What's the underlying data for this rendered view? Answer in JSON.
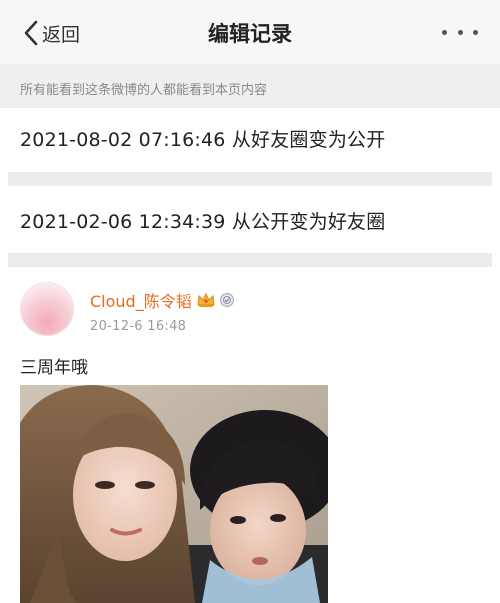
{
  "nav": {
    "back_label": "返回",
    "title": "编辑记录",
    "more_icon": "more-dots-icon"
  },
  "notice": "所有能看到这条微博的人都能看到本页内容",
  "records": [
    {
      "text": "2021-08-02 07:16:46 从好友圈变为公开"
    },
    {
      "text": "2021-02-06 12:34:39 从公开变为好友圈"
    }
  ],
  "post": {
    "username": "Cloud_陈令韬",
    "time": "20-12-6 16:48",
    "text": "三周年哦",
    "badges": [
      "crown-icon",
      "member-badge-icon"
    ],
    "photo": "couple-selfie-photo"
  },
  "colors": {
    "username": "#e86c1f",
    "notice_bg": "#efefef",
    "nav_bg": "#f7f7f7"
  }
}
